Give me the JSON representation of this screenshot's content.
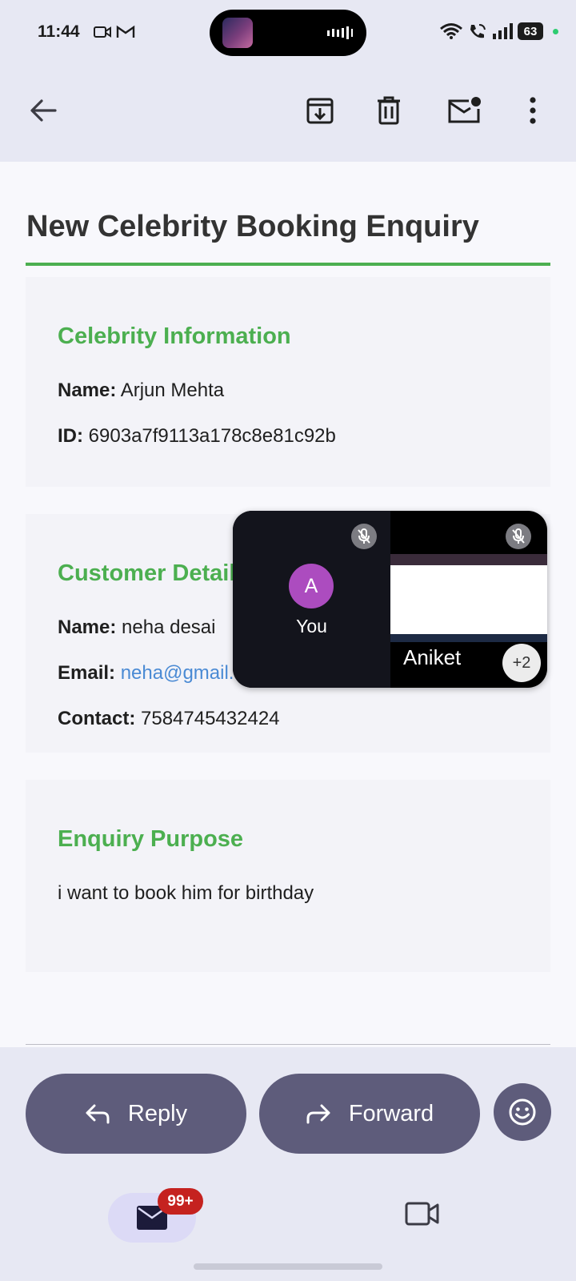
{
  "status_bar": {
    "time": "11:44",
    "battery": "63",
    "icons": [
      "video-camera-icon",
      "gmail-icon",
      "wifi-icon",
      "wifi-call-icon",
      "signal-icon",
      "battery-icon"
    ]
  },
  "toolbar": {
    "icons": [
      "back-arrow-icon",
      "archive-icon",
      "delete-icon",
      "mark-unread-icon",
      "more-vert-icon"
    ]
  },
  "email": {
    "title": "New Celebrity Booking Enquiry",
    "celebrity": {
      "heading": "Celebrity Information",
      "name_label": "Name:",
      "name_value": "Arjun Mehta",
      "id_label": "ID:",
      "id_value": "6903a7f9113a178c8e81c92b"
    },
    "customer": {
      "heading": "Customer Details",
      "name_label": "Name:",
      "name_value": "neha desai",
      "email_label": "Email:",
      "email_value": "neha@gmail.com",
      "contact_label": "Contact:",
      "contact_value": "7584745432424"
    },
    "purpose": {
      "heading": "Enquiry Purpose",
      "text": "i want to book him for birthday"
    }
  },
  "pip": {
    "avatar_letter": "A",
    "self_label": "You",
    "participant_name": "Aniket",
    "more_count": "+2"
  },
  "actions": {
    "reply_label": "Reply",
    "forward_label": "Forward"
  },
  "bottom_nav": {
    "mail_badge": "99+"
  },
  "colors": {
    "accent_green": "#4caf50",
    "pill_bg": "#5e5c7b",
    "link": "#4a8ad4",
    "badge": "#c5221f"
  }
}
